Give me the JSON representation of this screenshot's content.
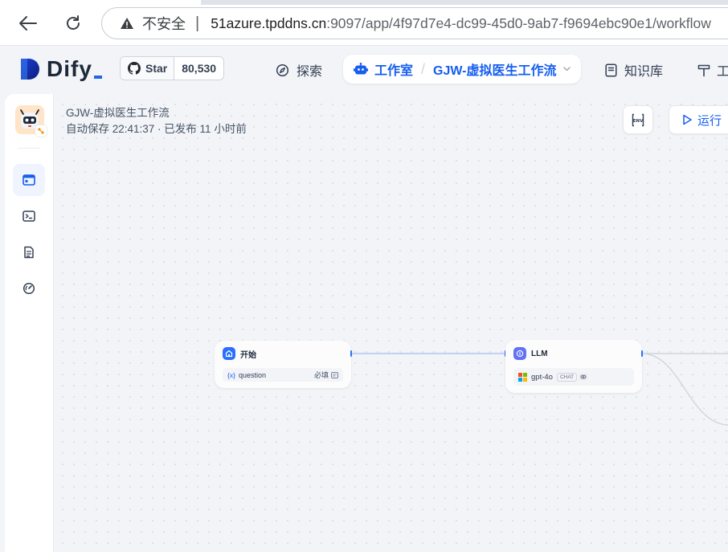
{
  "browser": {
    "insecure_label": "不安全",
    "separator": "|",
    "url_host": "51azure.tpddns.cn",
    "url_rest": ":9097/app/4f97d7e4-dc99-45d0-9ab7-f9694ebc90e1/workflow"
  },
  "topnav": {
    "logo_text": "Dify",
    "github": {
      "label": "Star",
      "count": "80,530"
    },
    "explore_label": "探索",
    "studio_label": "工作室",
    "breadcrumb_sep": "/",
    "app_name": "GJW-虚拟医生工作流",
    "knowledge_label": "知识库",
    "tools_label": "工"
  },
  "sidebar": {
    "items": [
      {
        "icon": "workflow-orchestrate-icon",
        "active": true
      },
      {
        "icon": "terminal-icon",
        "active": false
      },
      {
        "icon": "logs-icon",
        "active": false
      },
      {
        "icon": "monitoring-icon",
        "active": false
      }
    ]
  },
  "workflow": {
    "title": "GJW-虚拟医生工作流",
    "autosave_meta": "自动保存 22:41:37 · 已发布 11 小时前",
    "env_label": "ENV",
    "run_label": "运行"
  },
  "nodes": {
    "start": {
      "title": "开始",
      "var_prefix": "{x}",
      "var_name": "question",
      "required": "必填"
    },
    "llm": {
      "title": "LLM",
      "model": "gpt-4o",
      "mode": "CHAT"
    }
  },
  "colors": {
    "accent": "#155eef",
    "start_node": "#2970ff",
    "llm_node": "#6172f3",
    "canvas_bg": "#f2f4f7"
  }
}
